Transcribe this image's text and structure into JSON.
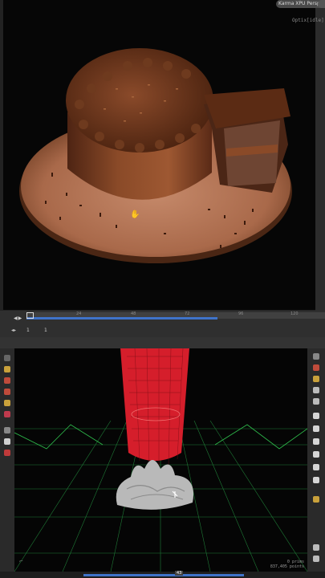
{
  "render_view": {
    "renderer_label": "Karma XPU Persp",
    "status_readout": "Optix[idle]"
  },
  "timeline": {
    "current_frame_marker": "1",
    "ticks": [
      "24",
      "48",
      "72",
      "96",
      "120"
    ],
    "start_frame": "1",
    "end_frame": "1",
    "progress_fraction": 0.64
  },
  "viewport": {
    "stats_line1": "0  prims",
    "stats_line2": "837,405 points",
    "bottom_frame": "43",
    "background_color": "#050505",
    "grid_color": "#2a9a43",
    "tube_color": "#d51e2b",
    "blob_color": "#b9b9b9"
  },
  "icons": {
    "play_controls": "playback-controls-icon",
    "cursor": "hand-cursor-icon"
  }
}
